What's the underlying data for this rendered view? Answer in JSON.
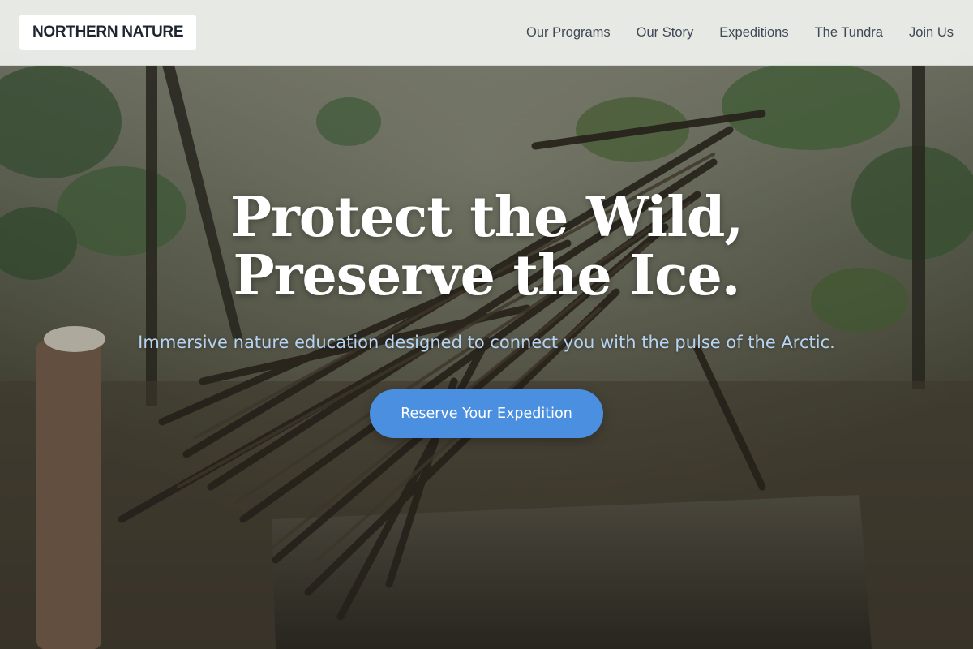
{
  "brand": {
    "name": "NORTHERN NATURE"
  },
  "nav": {
    "links": [
      "Our Programs",
      "Our Story",
      "Expeditions",
      "The Tundra",
      "Join Us"
    ]
  },
  "hero": {
    "title_line_1": "Protect the Wild,",
    "title_line_2": "Preserve the Ice.",
    "subtitle": "Immersive nature education designed to connect you with the pulse of the Arctic.",
    "cta_label": "Reserve Your Expedition",
    "background_subject": "twig-bird-sculpture-on-log-in-forest"
  },
  "colors": {
    "accent": "#4b8fe0",
    "subtitle": "#b6d3f2",
    "brand_text": "#1f2530",
    "nav_text": "#3f4856"
  }
}
